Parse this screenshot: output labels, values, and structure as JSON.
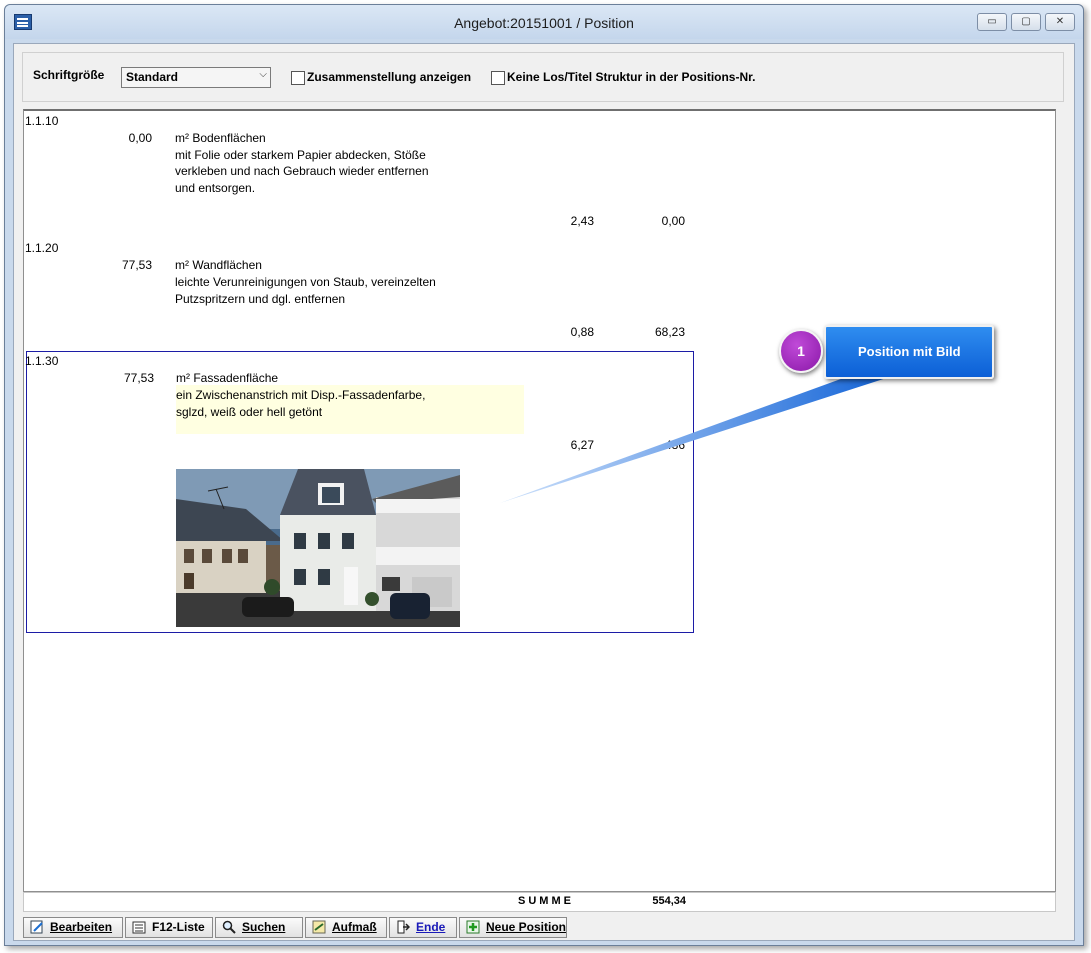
{
  "window": {
    "title": "Angebot:20151001  / Position",
    "minimize": "▭",
    "maximize": "▢",
    "close": "✕"
  },
  "options": {
    "font_size_label": "Schriftgröße",
    "font_size_value": "Standard",
    "show_summary_label": "Zusammenstellung anzeigen",
    "show_summary_checked": false,
    "no_structure_label": "Keine Los/Titel Struktur in der Positions-Nr.",
    "no_structure_checked": false
  },
  "positions": [
    {
      "nr": "1.1.10",
      "qty": "0,00",
      "title": "m² Bodenflächen",
      "desc": [
        "mit Folie oder starkem Papier abdecken, Stöße",
        "verkleben und nach Gebrauch wieder entfernen",
        "und entsorgen."
      ],
      "price": "2,43",
      "total": "0,00"
    },
    {
      "nr": "1.1.20",
      "qty": "77,53",
      "title": "m² Wandflächen",
      "desc": [
        "leichte Verunreinigungen von Staub, vereinzelten",
        "Putzspritzern und dgl. entfernen"
      ],
      "price": "0,88",
      "total": "68,23"
    },
    {
      "nr": "1.1.30",
      "qty": "77,53",
      "title": "m² Fassadenfläche",
      "desc": [
        "ein Zwischenanstrich mit Disp.-Fassadenfarbe,",
        "sglzd, weiß oder hell getönt"
      ],
      "price": "6,27",
      "total": "486"
    }
  ],
  "summary": {
    "label": "SUMME",
    "value": "554,34"
  },
  "buttons": {
    "edit": "Bearbeiten",
    "f12": "F12-Liste",
    "search": "Suchen",
    "measure": "Aufmaß",
    "end": "Ende",
    "new_position": "Neue Position"
  },
  "callout": {
    "number": "1",
    "text": "Position mit Bild"
  },
  "colors": {
    "selection_border": "#1c1ca6",
    "highlight_bg": "#ffffe1",
    "callout_blue": "#0c5fd6",
    "callout_purple": "#8a18a8",
    "end_label": "#1a1ab8"
  }
}
